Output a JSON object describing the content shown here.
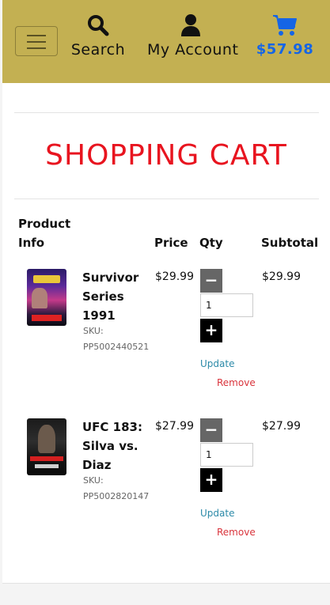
{
  "header": {
    "search_label": "Search",
    "account_label": "My Account",
    "cart_total": "$57.98",
    "search_icon": "search-icon",
    "account_icon": "user-icon",
    "cart_icon": "cart-icon",
    "bar_color": "#c3b052",
    "cart_color": "#1565e6"
  },
  "title": "SHOPPING CART",
  "columns": {
    "product_info": "Product Info",
    "price": "Price",
    "qty": "Qty",
    "subtotal": "Subtotal"
  },
  "items": [
    {
      "name": "Survivor Series 1991",
      "sku_label": "SKU:",
      "sku": "PP5002440521",
      "price": "$29.99",
      "qty": "1",
      "subtotal": "$29.99",
      "update": "Update",
      "remove": "Remove"
    },
    {
      "name": "UFC 183: Silva vs. Diaz",
      "sku_label": "SKU:",
      "sku": "PP5002820147",
      "price": "$27.99",
      "qty": "1",
      "subtotal": "$27.99",
      "update": "Update",
      "remove": "Remove"
    }
  ]
}
